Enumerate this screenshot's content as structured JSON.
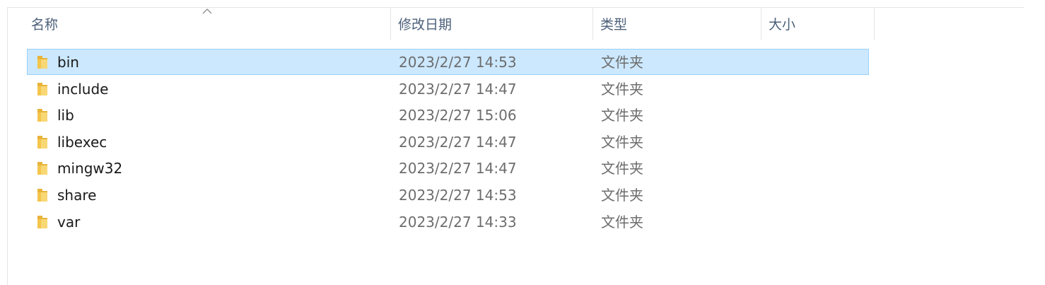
{
  "columns": {
    "name": "名称",
    "date": "修改日期",
    "type": "类型",
    "size": "大小"
  },
  "sort": {
    "column": "name",
    "direction": "ascending"
  },
  "folder_icon": "folder-icon",
  "colors": {
    "selected_bg": "#cce8ff",
    "selected_border": "#99d1ff",
    "header_text": "#4c607a",
    "folder": "#f4c54b"
  },
  "rows": [
    {
      "name": "bin",
      "date": "2023/2/27 14:53",
      "type": "文件夹",
      "size": "",
      "selected": true
    },
    {
      "name": "include",
      "date": "2023/2/27 14:47",
      "type": "文件夹",
      "size": "",
      "selected": false
    },
    {
      "name": "lib",
      "date": "2023/2/27 15:06",
      "type": "文件夹",
      "size": "",
      "selected": false
    },
    {
      "name": "libexec",
      "date": "2023/2/27 14:47",
      "type": "文件夹",
      "size": "",
      "selected": false
    },
    {
      "name": "mingw32",
      "date": "2023/2/27 14:47",
      "type": "文件夹",
      "size": "",
      "selected": false
    },
    {
      "name": "share",
      "date": "2023/2/27 14:53",
      "type": "文件夹",
      "size": "",
      "selected": false
    },
    {
      "name": "var",
      "date": "2023/2/27 14:33",
      "type": "文件夹",
      "size": "",
      "selected": false
    }
  ]
}
